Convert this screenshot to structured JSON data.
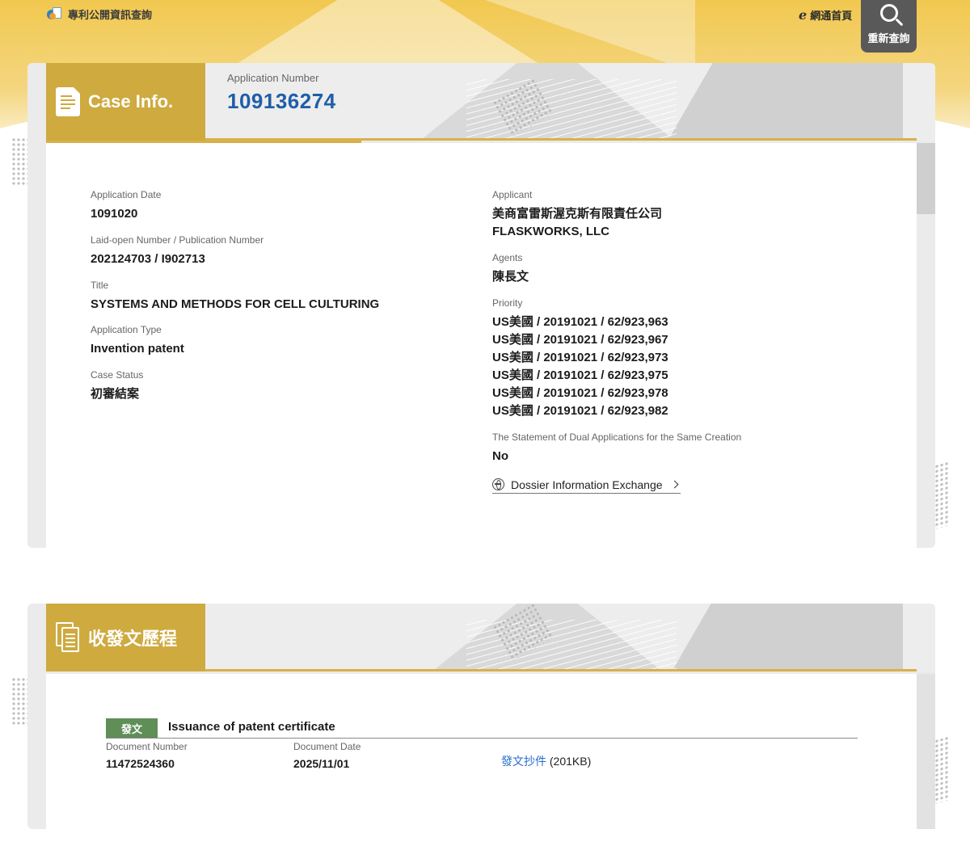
{
  "header": {
    "site_title": "專利公開資訊查詢",
    "home_label": "網通首頁",
    "search_label": "重新查詢"
  },
  "case_info": {
    "tab_title": "Case Info.",
    "app_number_label": "Application Number",
    "app_number": "109136274",
    "left_fields": [
      {
        "label": "Application Date",
        "value": "1091020"
      },
      {
        "label": "Laid-open Number / Publication Number",
        "value": "202124703 / I902713"
      },
      {
        "label": "Title",
        "value": "SYSTEMS AND METHODS FOR CELL CULTURING"
      },
      {
        "label": "Application Type",
        "value": "Invention patent"
      },
      {
        "label": "Case Status",
        "value": "初審結案"
      }
    ],
    "applicant": {
      "label": "Applicant",
      "lines": [
        "美商富雷斯渥克斯有限責任公司",
        "FLASKWORKS, LLC"
      ]
    },
    "agents": {
      "label": "Agents",
      "value": "陳長文"
    },
    "priority": {
      "label": "Priority",
      "lines": [
        "US美國 / 20191021 / 62/923,963",
        "US美國 / 20191021 / 62/923,967",
        "US美國 / 20191021 / 62/923,973",
        "US美國 / 20191021 / 62/923,975",
        "US美國 / 20191021 / 62/923,978",
        "US美國 / 20191021 / 62/923,982"
      ]
    },
    "dual_app": {
      "label": "The Statement of Dual Applications for the Same Creation",
      "value": "No"
    },
    "dossier_link": "Dossier Information Exchange"
  },
  "history": {
    "tab_title": "收發文歷程",
    "entries": [
      {
        "badge": "發文",
        "title": "Issuance of patent certificate",
        "doc_number_label": "Document Number",
        "doc_number": "11472524360",
        "doc_date_label": "Document Date",
        "doc_date": "2025/11/01",
        "copy_link": "發文抄件",
        "copy_size": "(201KB)"
      }
    ]
  },
  "colors": {
    "tab_gold": "#ceaa3f",
    "app_number_blue": "#1f5ea8",
    "badge_green": "#5f8e57",
    "link_blue": "#2a6fc9"
  }
}
